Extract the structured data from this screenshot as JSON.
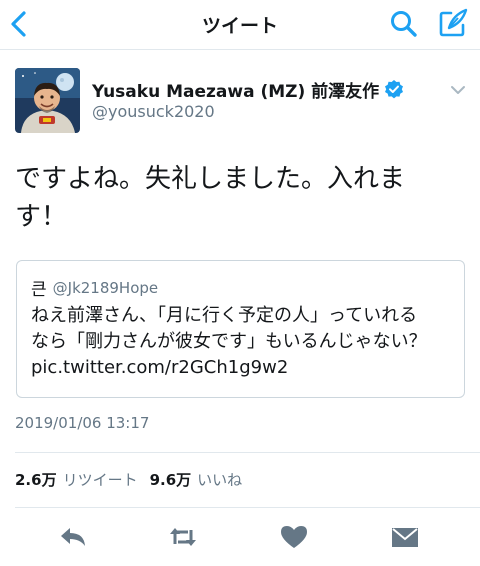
{
  "colors": {
    "accent": "#1da1f2",
    "icon_gray": "#657786",
    "text": "#14171a",
    "border": "#ccd6dd"
  },
  "nav": {
    "title": "ツイート",
    "back_icon": "chevron-left-icon",
    "search_icon": "search-icon",
    "compose_icon": "compose-icon"
  },
  "tweet": {
    "author_name": "Yusaku Maezawa (MZ) 前澤友作",
    "author_handle": "@yousuck2020",
    "verified": true,
    "text_lines": [
      "ですよね。失礼しました。入れま",
      "す！"
    ],
    "timestamp": "2019/01/06 13:17"
  },
  "quote": {
    "name": "큰",
    "handle": "@Jk2189Hope",
    "text_lines": [
      "ねえ前澤さん、「月に行く予定の人」っていれる",
      "なら「剛力さんが彼女です」もいるんじゃない？",
      "pic.twitter.com/r2GCh1g9w2"
    ]
  },
  "stats": {
    "retweets_count": "2.6万",
    "retweets_label": "リツイート",
    "likes_count": "9.6万",
    "likes_label": "いいね"
  },
  "actions": [
    "reply-icon",
    "retweet-icon",
    "like-icon",
    "message-icon"
  ]
}
